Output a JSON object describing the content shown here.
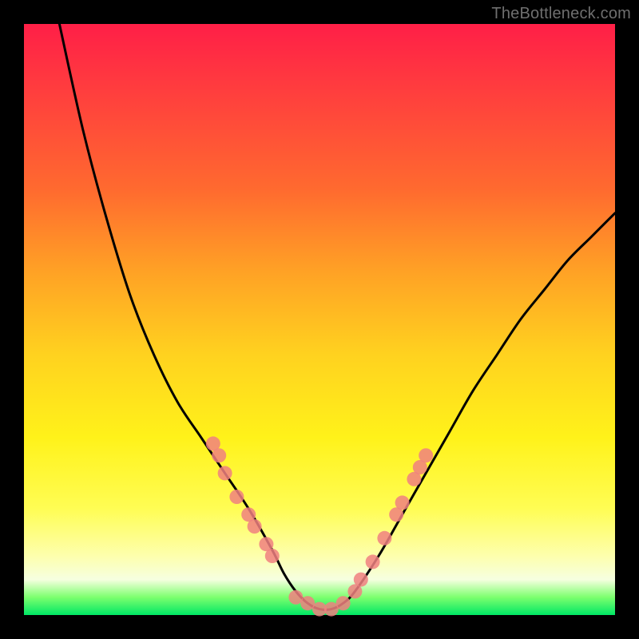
{
  "watermark": {
    "text": "TheBottleneck.com"
  },
  "chart_data": {
    "type": "line",
    "title": "",
    "xlabel": "",
    "ylabel": "",
    "xlim": [
      0,
      100
    ],
    "ylim": [
      0,
      100
    ],
    "grid": false,
    "legend": false,
    "series": [
      {
        "name": "bottleneck-curve",
        "color": "#000000",
        "x": [
          6,
          10,
          14,
          18,
          22,
          26,
          30,
          34,
          38,
          42,
          44,
          46,
          48,
          50,
          52,
          54,
          56,
          60,
          64,
          68,
          72,
          76,
          80,
          84,
          88,
          92,
          96,
          100
        ],
        "values": [
          100,
          82,
          67,
          54,
          44,
          36,
          30,
          24,
          18,
          11,
          7,
          4,
          2,
          1,
          1,
          2,
          4,
          10,
          17,
          24,
          31,
          38,
          44,
          50,
          55,
          60,
          64,
          68
        ]
      }
    ],
    "markers": {
      "name": "highlighted-points",
      "color": "#f08080",
      "points": [
        {
          "x": 32,
          "y": 29
        },
        {
          "x": 33,
          "y": 27
        },
        {
          "x": 34,
          "y": 24
        },
        {
          "x": 36,
          "y": 20
        },
        {
          "x": 38,
          "y": 17
        },
        {
          "x": 39,
          "y": 15
        },
        {
          "x": 41,
          "y": 12
        },
        {
          "x": 42,
          "y": 10
        },
        {
          "x": 46,
          "y": 3
        },
        {
          "x": 48,
          "y": 2
        },
        {
          "x": 50,
          "y": 1
        },
        {
          "x": 52,
          "y": 1
        },
        {
          "x": 54,
          "y": 2
        },
        {
          "x": 56,
          "y": 4
        },
        {
          "x": 57,
          "y": 6
        },
        {
          "x": 59,
          "y": 9
        },
        {
          "x": 61,
          "y": 13
        },
        {
          "x": 63,
          "y": 17
        },
        {
          "x": 64,
          "y": 19
        },
        {
          "x": 66,
          "y": 23
        },
        {
          "x": 67,
          "y": 25
        },
        {
          "x": 68,
          "y": 27
        }
      ]
    },
    "background_gradient": {
      "top": "#ff1f47",
      "mid_high": "#ffa225",
      "mid": "#fff21a",
      "mid_low": "#fdffad",
      "bottom": "#00e765"
    }
  }
}
